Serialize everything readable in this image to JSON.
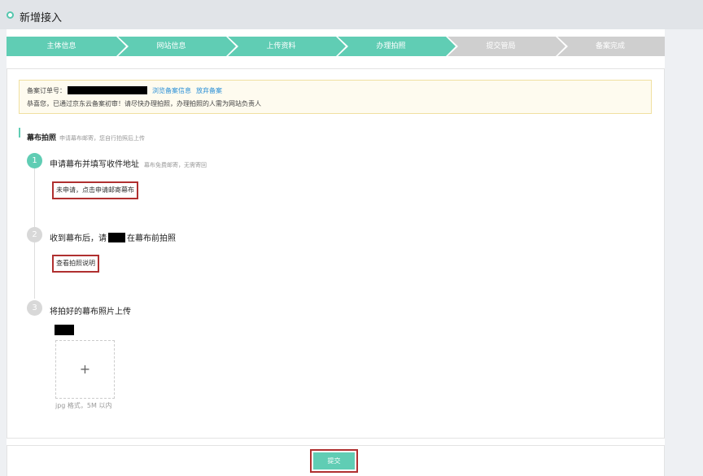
{
  "header": {
    "title": "新增接入"
  },
  "progress": {
    "steps": [
      {
        "label": "主体信息",
        "status": "done"
      },
      {
        "label": "网站信息",
        "status": "done"
      },
      {
        "label": "上传资料",
        "status": "done"
      },
      {
        "label": "办理拍照",
        "status": "current"
      },
      {
        "label": "提交管局",
        "status": "todo"
      },
      {
        "label": "备案完成",
        "status": "todo"
      }
    ]
  },
  "notice": {
    "order_label": "备案订单号：",
    "view_link": "浏览备案信息",
    "abandon_link": "放弃备案",
    "message": "恭喜您，已通过京东云备案初审！请尽快办理拍照，办理拍照的人需为网站负责人"
  },
  "section": {
    "title": "幕布拍照",
    "hint": "申请幕布邮寄，您自行拍照后上传"
  },
  "steps": [
    {
      "number": "1",
      "title": "申请幕布并填写收件地址",
      "hint": "幕布免费邮寄，无需寄回",
      "action": "未申请，点击申请邮寄幕布"
    },
    {
      "number": "2",
      "title_before": "收到幕布后，请",
      "title_after": "在幕布前拍照",
      "action": "查看拍照说明"
    },
    {
      "number": "3",
      "title": "将拍好的幕布照片上传",
      "upload_icon": "+",
      "upload_hint": "jpg 格式，5M 以内"
    }
  ],
  "footer": {
    "submit_label": "提交"
  },
  "colors": {
    "accent": "#60cdb4",
    "inactive": "#cfcfcf",
    "highlight_border": "#b03030",
    "link": "#2a8fd6"
  }
}
